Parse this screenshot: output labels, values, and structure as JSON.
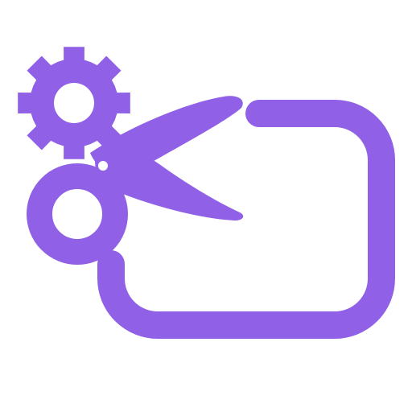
{
  "icon": {
    "name": "screenshot-settings-icon",
    "color": "#9061e6",
    "background": "#ffffff",
    "parts": [
      "gear-icon",
      "scissors-icon",
      "frame-icon"
    ]
  }
}
